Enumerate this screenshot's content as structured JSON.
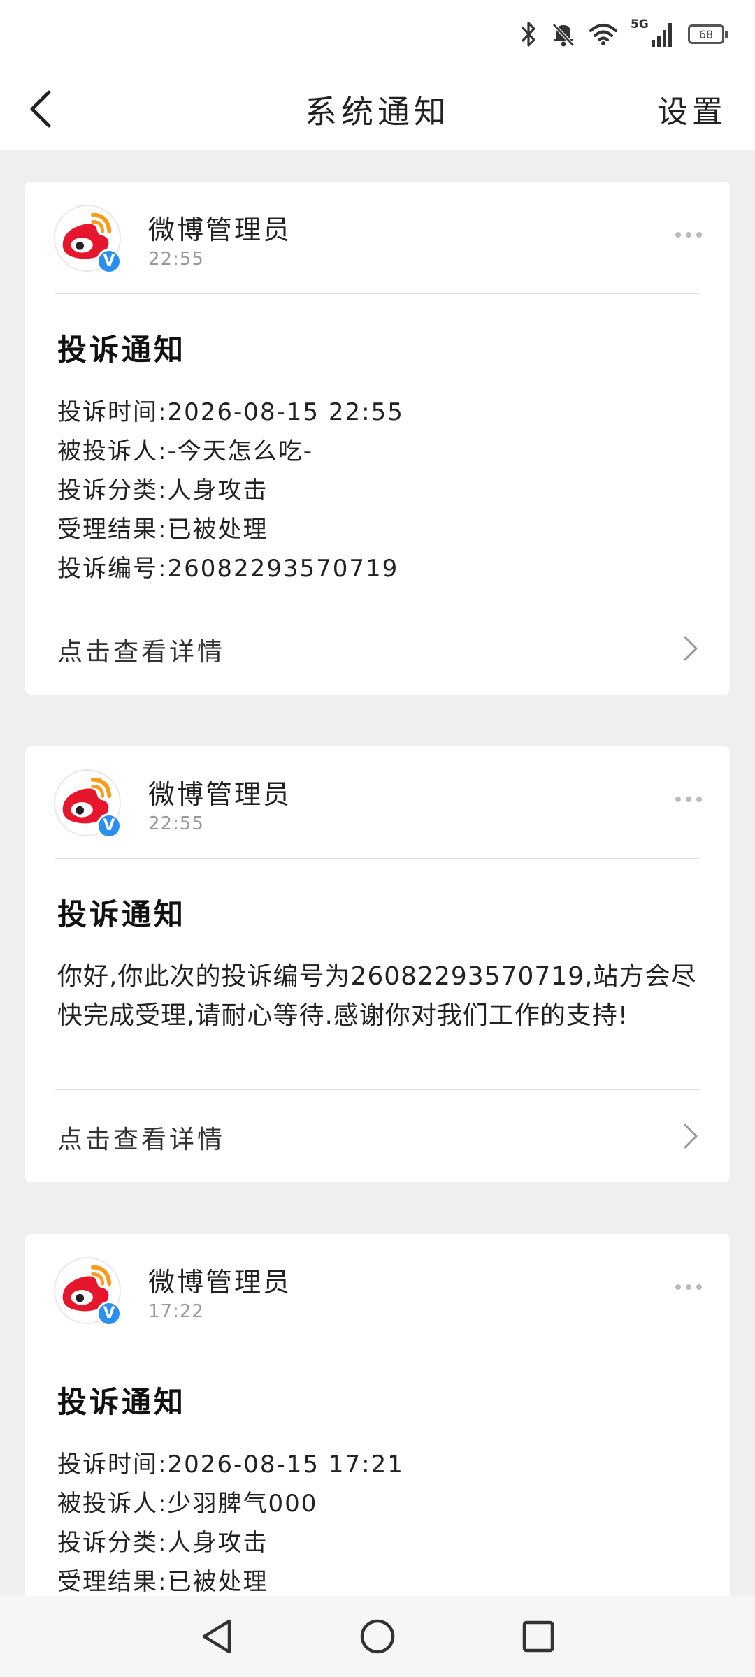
{
  "status_bar": {
    "network": "5G",
    "battery": "68",
    "icons": [
      "bluetooth-icon",
      "bell-muted-icon",
      "wifi-icon",
      "cellular-signal-icon",
      "battery-icon"
    ]
  },
  "header": {
    "title": "系统通知",
    "settings_label": "设置"
  },
  "cards": [
    {
      "sender": "微博管理员",
      "time": "22:55",
      "badge": "V",
      "title": "投诉通知",
      "lines": [
        "投诉时间:2026-08-15 22:55",
        "被投诉人:-今天怎么吃-",
        "投诉分类:人身攻击",
        "受理结果:已被处理",
        "投诉编号:26082293570719"
      ],
      "detail_label": "点击查看详情"
    },
    {
      "sender": "微博管理员",
      "time": "22:55",
      "badge": "V",
      "title": "投诉通知",
      "paragraph": "你好,你此次的投诉编号为26082293570719,站方会尽快完成受理,请耐心等待.感谢你对我们工作的支持!",
      "detail_label": "点击查看详情"
    },
    {
      "sender": "微博管理员",
      "time": "17:22",
      "badge": "V",
      "title": "投诉通知",
      "lines": [
        "投诉时间:2026-08-15 17:21",
        "被投诉人:少羽脾气000",
        "投诉分类:人身攻击",
        "受理结果:已被处理"
      ]
    }
  ],
  "colors": {
    "weibo_red": "#e6162d",
    "weibo_orange": "#f79c1c",
    "verified_blue": "#2b8ff0",
    "page_bg": "#efefef"
  }
}
